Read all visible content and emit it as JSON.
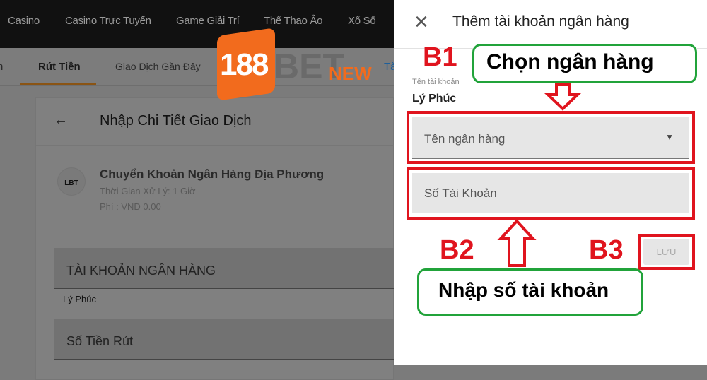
{
  "topnav": {
    "items": [
      "Casino",
      "Casino Trực Tuyến",
      "Game Giải Trí",
      "Thể Thao Ảo",
      "Xổ Số"
    ]
  },
  "subnav": {
    "items": [
      "n",
      "Rút Tiền",
      "Giao Dịch Gần Đây",
      "Tà"
    ],
    "active": "Rút Tiền"
  },
  "logo": {
    "text": "188BETNEW",
    "color": "#f26b1d"
  },
  "card": {
    "title": "Nhập Chi Tiết Giao Dịch",
    "method": {
      "icon_label": "LBT",
      "name": "Chuyển Khoản Ngân Hàng Địa Phương",
      "time": "Thời Gian Xử Lý: 1 Giờ",
      "fee": "Phí : VND 0.00"
    },
    "bank_account_label": "TÀI KHOẢN NGÂN HÀNG",
    "bank_account_value": "Lý Phúc",
    "amount_label": "Số Tiền Rút"
  },
  "panel": {
    "title": "Thêm tài khoản ngân hàng",
    "account_name_label": "Tên tài khoản",
    "account_name_value": "Lý Phúc",
    "bank_select_placeholder": "Tên ngân hàng",
    "account_number_placeholder": "Số Tài Khoản",
    "save_label": "LƯU"
  },
  "annotations": {
    "b1": "B1",
    "b2": "B2",
    "b3": "B3",
    "step1": "Chọn ngân hàng",
    "step2": "Nhập số tài khoản",
    "red": "#e0141e",
    "green": "#21a33a"
  }
}
